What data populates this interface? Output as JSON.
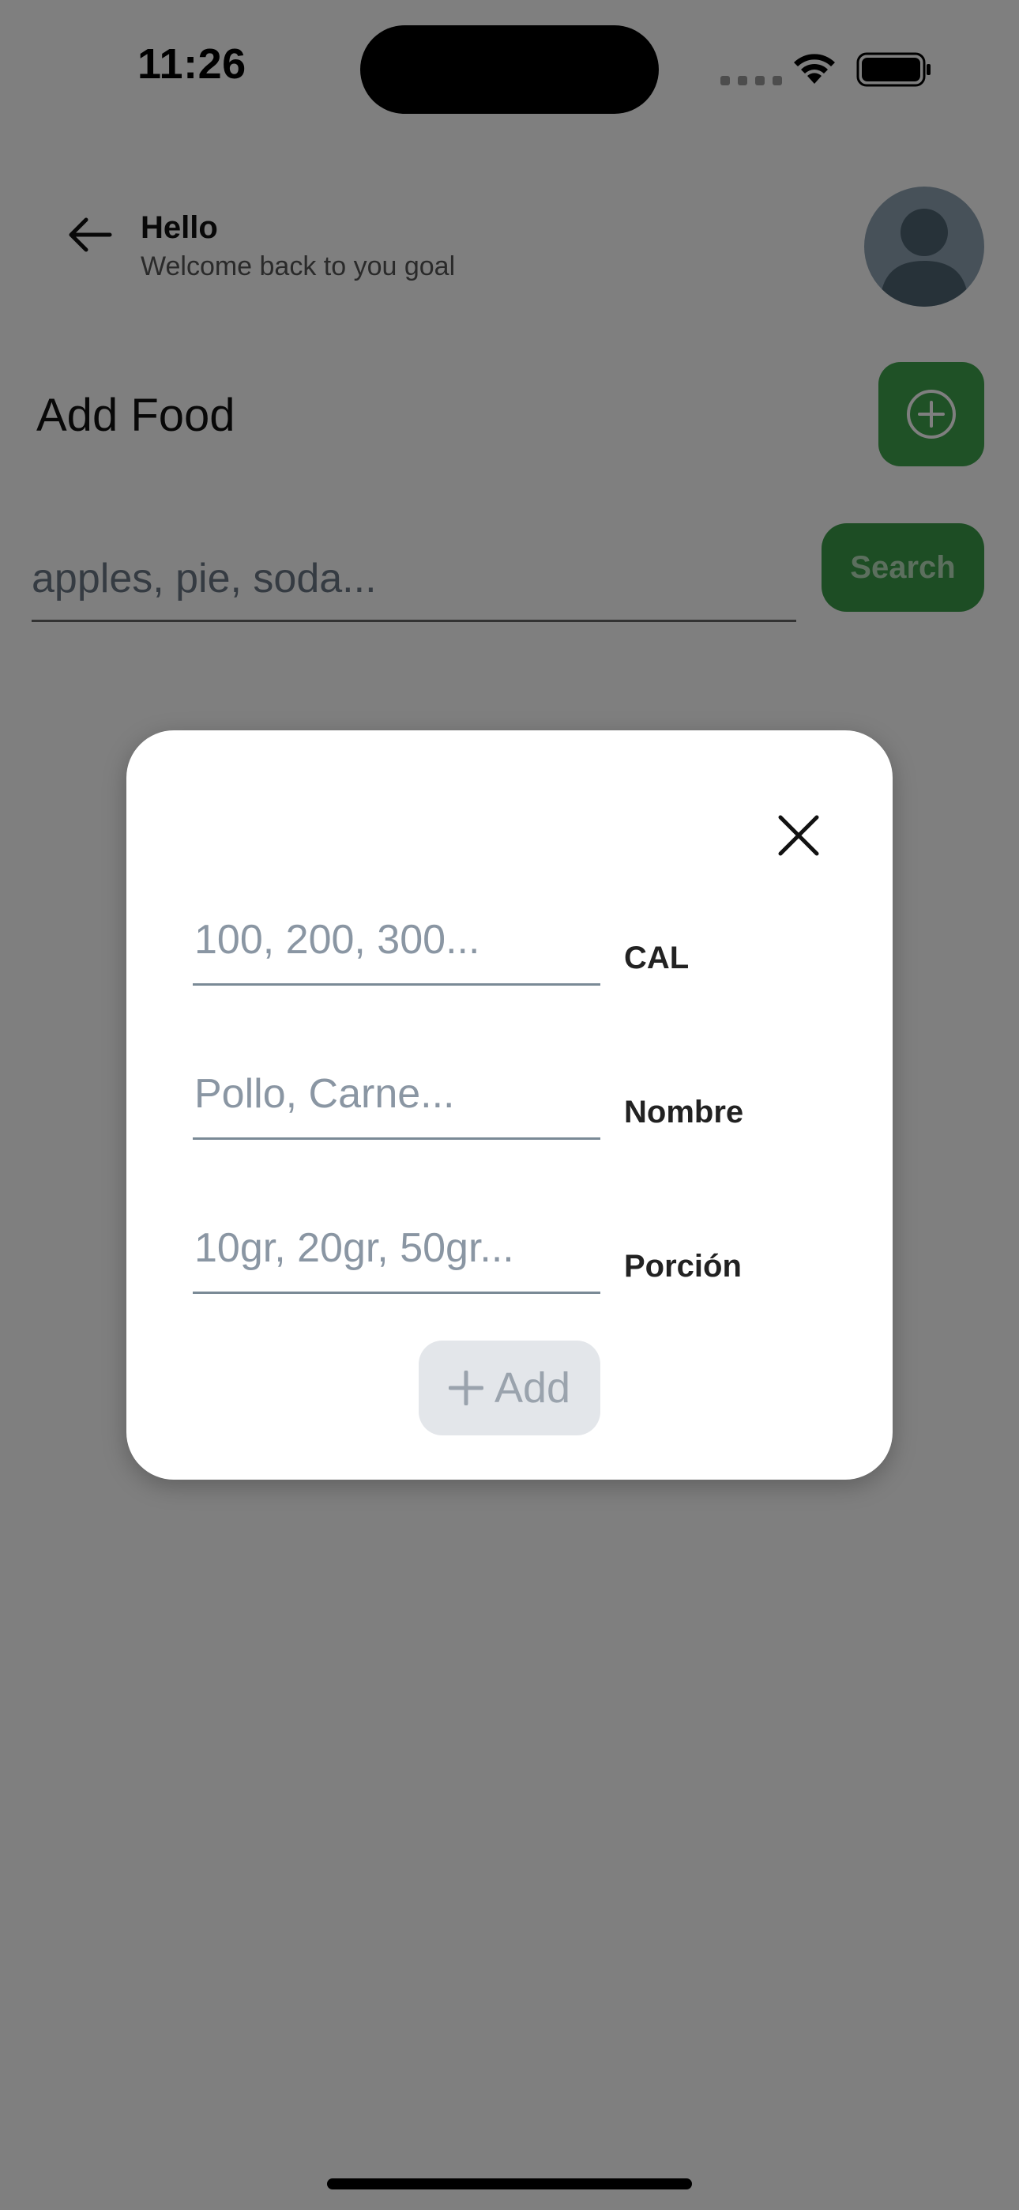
{
  "status_bar": {
    "time": "11:26"
  },
  "header": {
    "greeting": "Hello",
    "subtitle": "Welcome back to you goal"
  },
  "page": {
    "title": "Add Food"
  },
  "search": {
    "placeholder": "apples, pie, soda...",
    "button_label": "Search"
  },
  "modal": {
    "fields": [
      {
        "placeholder": "100, 200, 300...",
        "label": "CAL"
      },
      {
        "placeholder": "Pollo, Carne...",
        "label": "Nombre"
      },
      {
        "placeholder": "10gr, 20gr, 50gr...",
        "label": "Porción"
      }
    ],
    "add_label": "Add"
  },
  "colors": {
    "accent": "#3fa34d",
    "overlay": "rgba(0,0,0,0.5)",
    "disabled": "#e3e6ea"
  },
  "icons": [
    "back-arrow-icon",
    "avatar-icon",
    "plus-circle-icon",
    "close-icon",
    "plus-icon",
    "wifi-icon",
    "battery-icon",
    "signal-icon"
  ]
}
